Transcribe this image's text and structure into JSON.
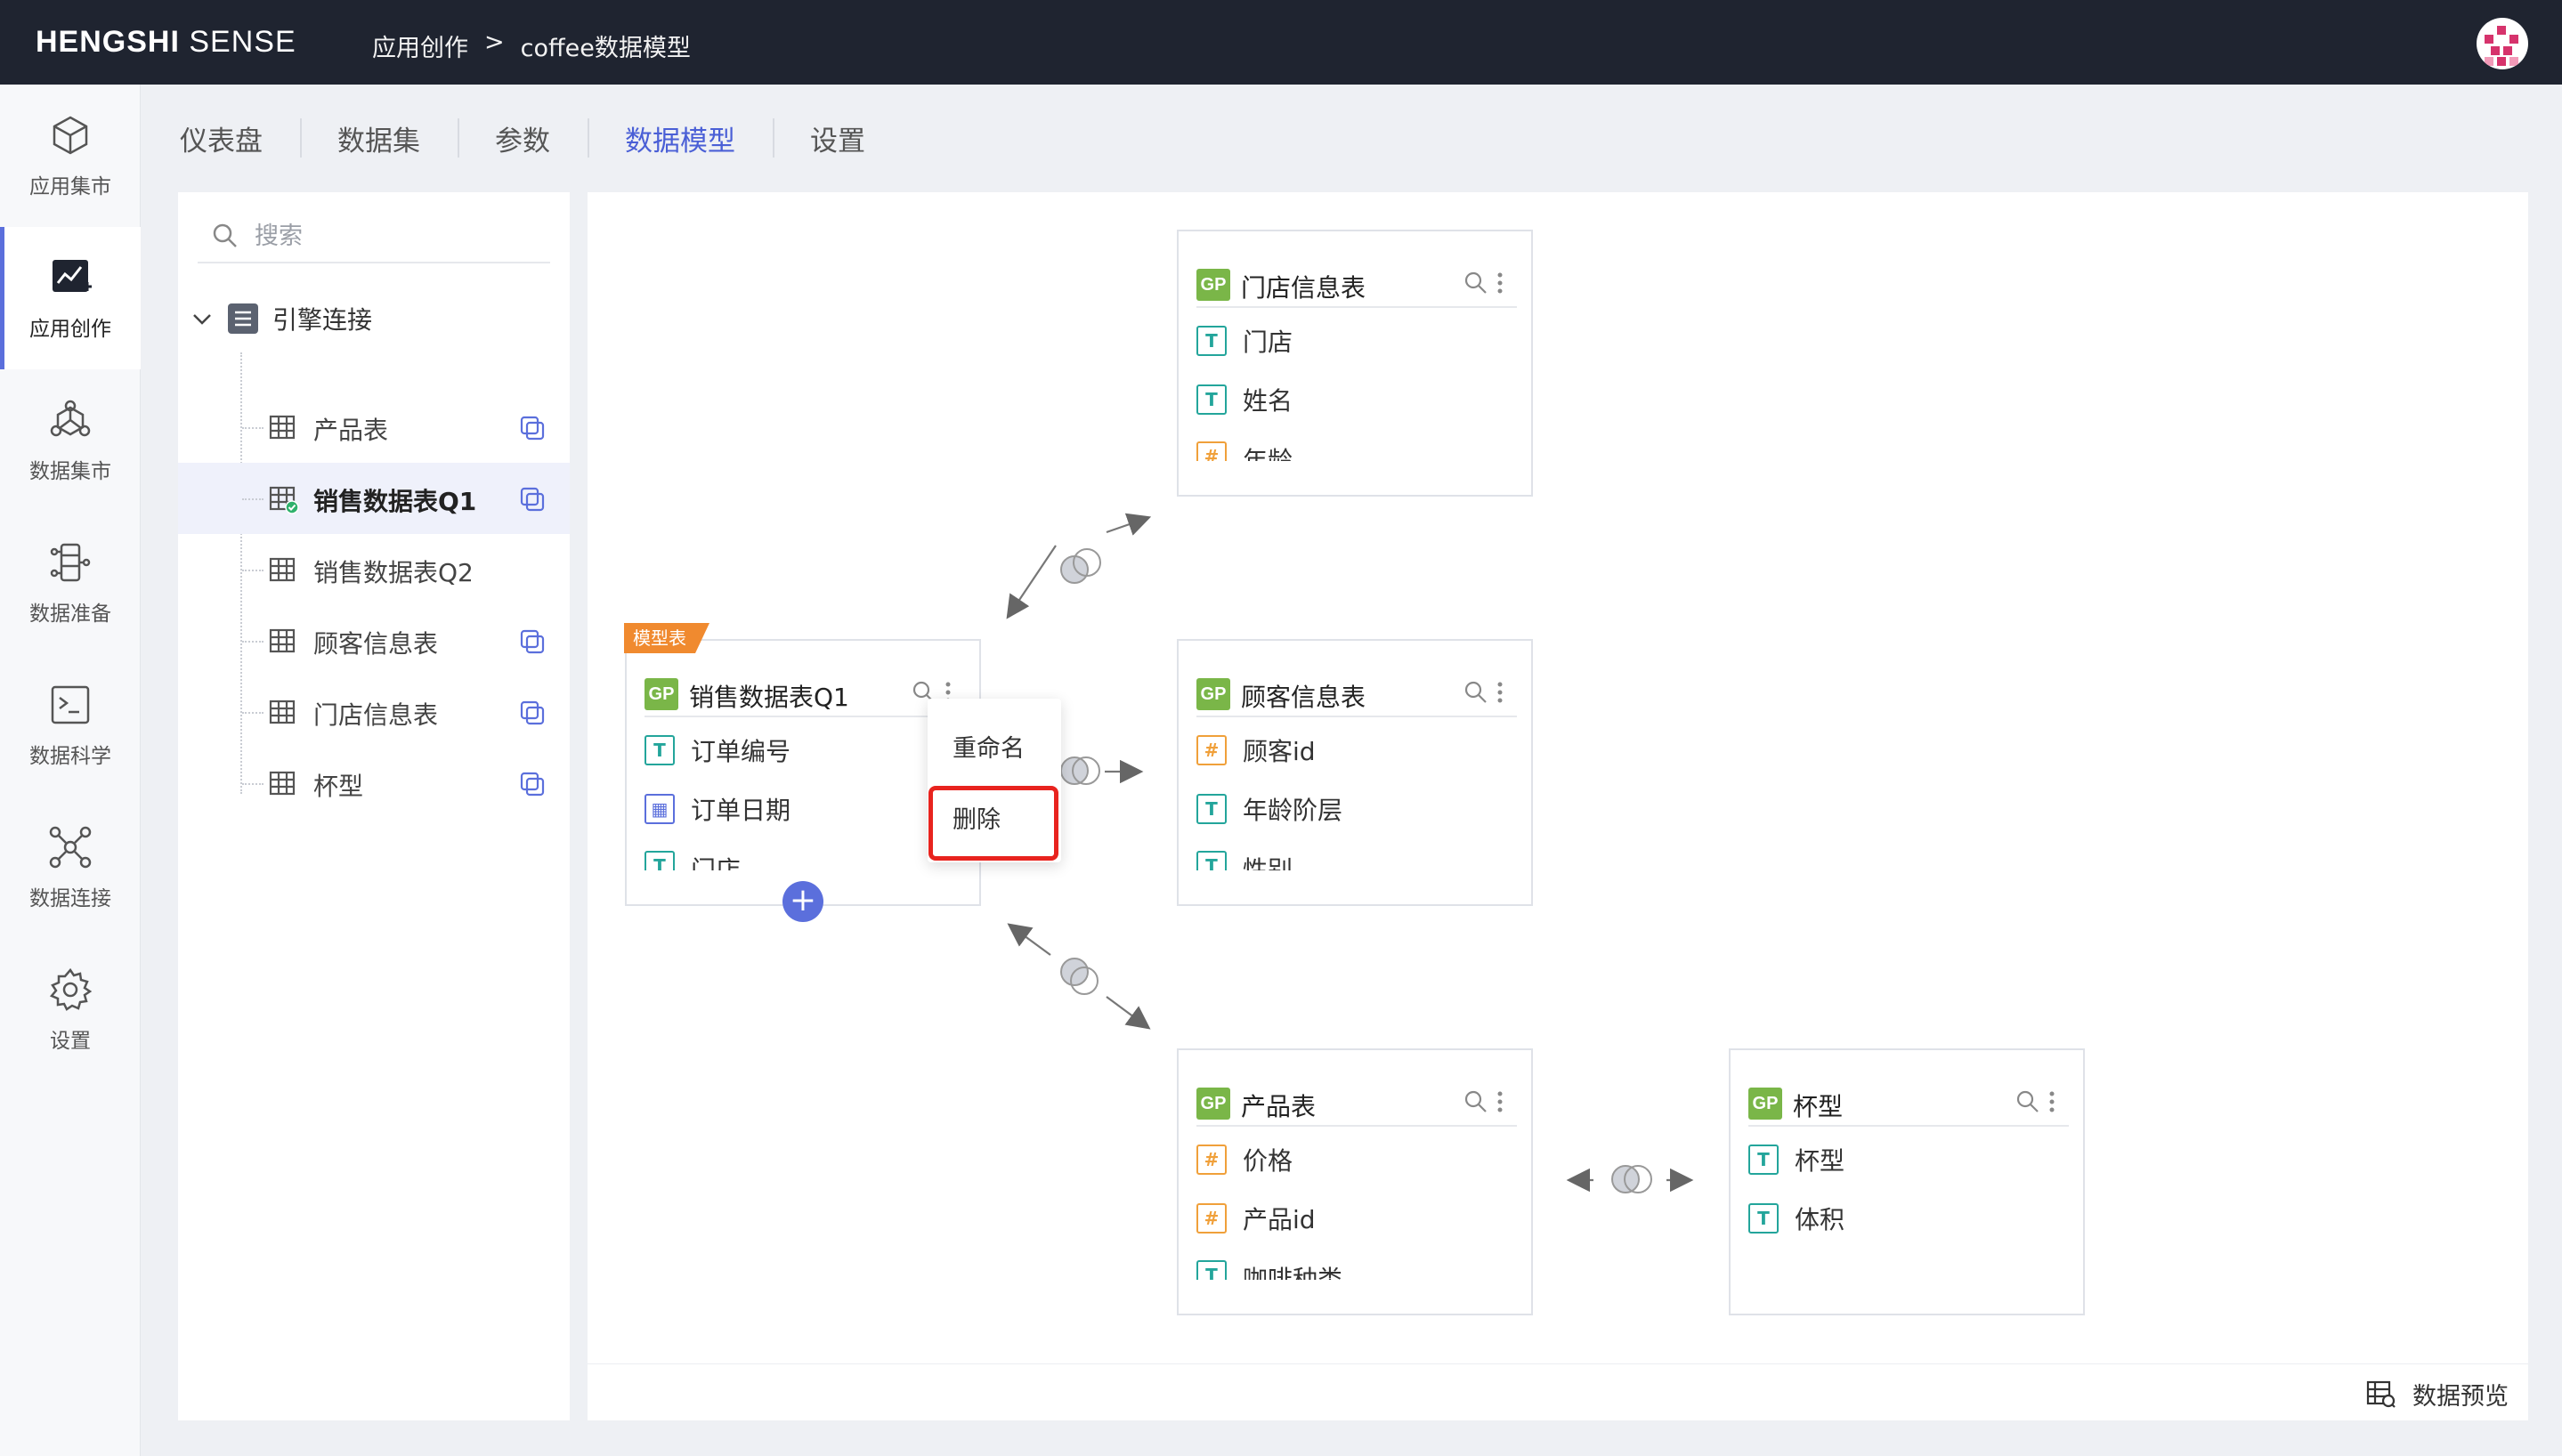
{
  "header": {
    "brand_bold": "HENGSHI",
    "brand_light": "SENSE",
    "breadcrumb": [
      "应用创作",
      ">",
      "coffee数据模型"
    ]
  },
  "left_nav": [
    {
      "label": "应用集市",
      "icon": "cube-icon"
    },
    {
      "label": "应用创作",
      "icon": "chart-create-icon",
      "active": true
    },
    {
      "label": "数据集市",
      "icon": "data-mart-icon"
    },
    {
      "label": "数据准备",
      "icon": "data-prep-icon"
    },
    {
      "label": "数据科学",
      "icon": "terminal-icon"
    },
    {
      "label": "数据连接",
      "icon": "network-icon"
    },
    {
      "label": "设置",
      "icon": "gear-icon"
    }
  ],
  "tabs": [
    {
      "label": "仪表盘"
    },
    {
      "label": "数据集"
    },
    {
      "label": "参数"
    },
    {
      "label": "数据模型",
      "active": true
    },
    {
      "label": "设置"
    }
  ],
  "sidebar": {
    "search_placeholder": "搜索",
    "root_label": "引擎连接",
    "items": [
      {
        "label": "产品表",
        "copy": true
      },
      {
        "label": "销售数据表Q1",
        "copy": true,
        "selected": true
      },
      {
        "label": "销售数据表Q2",
        "copy": false
      },
      {
        "label": "顾客信息表",
        "copy": true
      },
      {
        "label": "门店信息表",
        "copy": true
      },
      {
        "label": "杯型",
        "copy": true
      }
    ]
  },
  "canvas": {
    "model_tag": "模型表",
    "badge_text": "GP",
    "cards": {
      "store": {
        "title": "门店信息表",
        "fields": [
          {
            "type": "T",
            "name": "门店"
          },
          {
            "type": "T",
            "name": "姓名"
          },
          {
            "type": "#",
            "name": "年龄"
          }
        ]
      },
      "sales": {
        "title": "销售数据表Q1",
        "fields": [
          {
            "type": "T",
            "name": "订单编号"
          },
          {
            "type": "date",
            "name": "订单日期"
          },
          {
            "type": "T",
            "name": "门店"
          }
        ]
      },
      "customer": {
        "title": "顾客信息表",
        "fields": [
          {
            "type": "#",
            "name": "顾客id"
          },
          {
            "type": "T",
            "name": "年龄阶层"
          },
          {
            "type": "T",
            "name": "性别"
          }
        ]
      },
      "product": {
        "title": "产品表",
        "fields": [
          {
            "type": "#",
            "name": "价格"
          },
          {
            "type": "#",
            "name": "产品id"
          },
          {
            "type": "T",
            "name": "咖啡种类"
          }
        ]
      },
      "cup": {
        "title": "杯型",
        "fields": [
          {
            "type": "T",
            "name": "杯型"
          },
          {
            "type": "T",
            "name": "体积"
          }
        ]
      }
    },
    "context_menu": {
      "rename": "重命名",
      "delete": "删除"
    },
    "preview_label": "数据预览",
    "highlight_color": "#e8231e",
    "accent_color": "#5b6fdc"
  }
}
